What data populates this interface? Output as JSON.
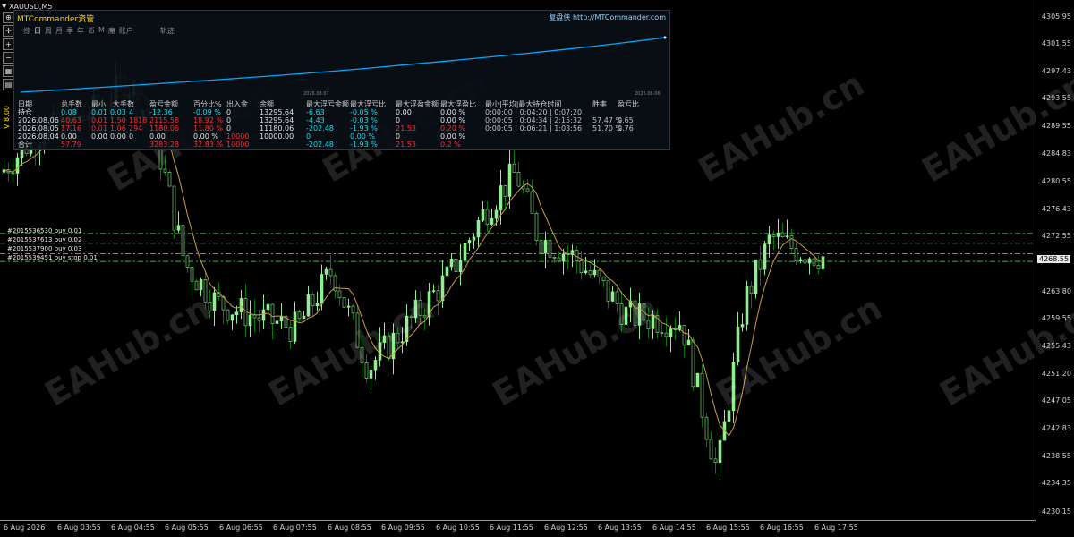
{
  "symbol": "XAUUSD,M5",
  "side_label": "V 8.00",
  "toolbar": {
    "buttons": [
      {
        "name": "crosshair-icon",
        "glyph": "⊕"
      },
      {
        "name": "move-icon",
        "glyph": "✛"
      },
      {
        "name": "zoom-in-icon",
        "glyph": "+"
      },
      {
        "name": "zoom-out-icon",
        "glyph": "−"
      },
      {
        "name": "grid-icon",
        "glyph": "▦"
      },
      {
        "name": "properties-icon",
        "glyph": "▤"
      }
    ]
  },
  "price_axis": {
    "current_price": "4268.55",
    "labels": [
      "4305.95",
      "4301.55",
      "4297.43",
      "4293.55",
      "4289.55",
      "4284.83",
      "4280.55",
      "4276.43",
      "4272.55",
      "4263.80",
      "4259.55",
      "4255.43",
      "4251.20",
      "4247.05",
      "4242.83",
      "4238.55",
      "4234.35",
      "4230.15"
    ]
  },
  "time_axis": {
    "labels": [
      "6 Aug 2026",
      "6 Aug 03:55",
      "6 Aug 04:55",
      "6 Aug 05:55",
      "6 Aug 06:55",
      "6 Aug 07:55",
      "6 Aug 08:55",
      "6 Aug 09:55",
      "6 Aug 10:55",
      "6 Aug 11:55",
      "6 Aug 12:55",
      "6 Aug 13:55",
      "6 Aug 14:55",
      "6 Aug 15:55",
      "6 Aug 16:55",
      "6 Aug 17:55"
    ]
  },
  "orders": [
    "#2015536530 buy 0.01",
    "#2015537613 buy 0.02",
    "#2015537900 buy 0.03",
    "#2015539451 buy stop 0.01"
  ],
  "panel": {
    "title": "MTCommander资管",
    "right_label": "复盘侠",
    "right_url": "http://MTCommander.com",
    "tabs": [
      "综",
      "日",
      "周",
      "月",
      "季",
      "年",
      "币",
      "M",
      "魔",
      "账户"
    ],
    "tab_extra": "轨迹",
    "mini_dates": [
      "2026.08.07",
      "2026.08.06"
    ],
    "table": {
      "headers": [
        "日期",
        "总手数",
        "最小",
        "大手数",
        "盈亏金额",
        "百分比%",
        "出入金",
        "余额",
        "最大浮亏金额",
        "最大浮亏比",
        "最大浮盈金额",
        "最大浮盈比",
        "最小|平均|最大持仓时间",
        "胜率",
        "盈亏比"
      ],
      "rows": [
        {
          "date": "持仓",
          "lots": "0.08",
          "min": "0.01",
          "max": "0.03",
          "count": "4",
          "pnl": "-12.36",
          "pct": "-0.09 %",
          "io": "0",
          "balance": "13295.64",
          "mfl": "-6.63",
          "mflp": "-0.05 %",
          "mfp": "0.00",
          "mfpp": "0.00 %",
          "hold": "0:00:00 | 0:04:20 | 0:07:20",
          "win": "",
          "pr": ""
        },
        {
          "date": "2026.08.06",
          "lots": "40.63",
          "min": "0.01",
          "max": "1.50",
          "count": "1818",
          "pnl": "2115.58",
          "pct": "18.92 %",
          "io": "0",
          "balance": "13295.64",
          "mfl": "-4.43",
          "mflp": "-0.03 %",
          "mfp": "0",
          "mfpp": "0.00 %",
          "hold": "0:00:05 | 0:04:34 | 2:15:32",
          "win": "57.47 %",
          "pr": "0.65"
        },
        {
          "date": "2026.08.05",
          "lots": "17.16",
          "min": "0.01",
          "max": "1.06",
          "count": "294",
          "pnl": "1180.06",
          "pct": "11.80 %",
          "io": "0",
          "balance": "11180.06",
          "mfl": "-202.48",
          "mflp": "-1.93 %",
          "mfp": "21.53",
          "mfpp": "0.20 %",
          "hold": "0:00:05 | 0:06:21 | 1:03:56",
          "win": "51.70 %",
          "pr": "0.76"
        },
        {
          "date": "2026.08.04",
          "lots": "0.00",
          "min": "0.00",
          "max": "0.00",
          "count": "0",
          "pnl": "0.00",
          "pct": "0.00 %",
          "io": "10000",
          "balance": "10000.00",
          "mfl": "0",
          "mflp": "0.00 %",
          "mfp": "0",
          "mfpp": "0.00 %",
          "hold": "",
          "win": "",
          "pr": ""
        },
        {
          "date": "合计",
          "lots": "57.79",
          "min": "",
          "max": "",
          "count": "",
          "pnl": "3283.28",
          "pct": "32.83 %",
          "io": "10000",
          "balance": "",
          "mfl": "-202.48",
          "mflp": "-1.93 %",
          "mfp": "21.53",
          "mfpp": "0.2 %",
          "hold": "",
          "win": "",
          "pr": ""
        }
      ]
    }
  },
  "watermark_text": "EAHub.cn",
  "colors": {
    "bull": "#90ee90",
    "bear": "#007a00",
    "ma": "#c8a03c",
    "order_line": "#4caf50",
    "equity": "#00aaff"
  }
}
